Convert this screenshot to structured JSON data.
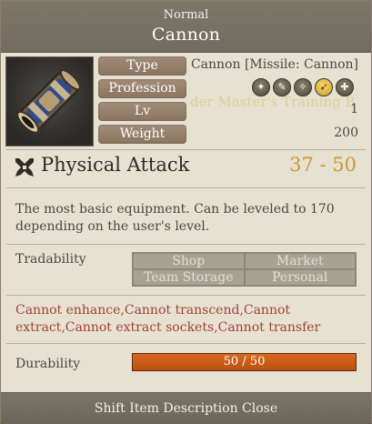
{
  "header": {
    "grade": "Normal",
    "item_name": "Cannon"
  },
  "item_icon": "cannon-icon",
  "stats": {
    "type_label": "Type",
    "type_value": "Cannon [Missile: Cannon]",
    "profession_label": "Profession",
    "lv_label": "Lv",
    "lv_value": "1",
    "weight_label": "Weight",
    "weight_value": "200",
    "background_text": "der Master's Training B"
  },
  "professions": [
    {
      "icon": "archer-icon",
      "glyph": "✦",
      "active": false
    },
    {
      "icon": "wizard-icon",
      "glyph": "✎",
      "active": false
    },
    {
      "icon": "cleric-icon",
      "glyph": "✧",
      "active": false
    },
    {
      "icon": "scout-icon",
      "glyph": "➶",
      "active": true
    },
    {
      "icon": "swordsman-icon",
      "glyph": "✚",
      "active": false
    }
  ],
  "attack": {
    "label": "Physical Attack",
    "value": "37 - 50",
    "icon": "crossed-swords-icon"
  },
  "description": "The most basic equipment. Can be leveled to 170 depending on the user's level.",
  "tradability": {
    "label": "Tradability",
    "options": [
      "Shop",
      "Market",
      "Team Storage",
      "Personal"
    ]
  },
  "restrictions": "Cannot enhance,Cannot transcend,Cannot extract,Cannot extract sockets,Cannot transfer",
  "durability": {
    "label": "Durability",
    "text": "50 / 50",
    "current": 50,
    "max": 50
  },
  "footer": {
    "text": "Shift Item Description Close"
  },
  "colors": {
    "attack_value": "#c89a2a",
    "restriction_text": "#a0433a",
    "durability_bar": "#d8681e"
  }
}
